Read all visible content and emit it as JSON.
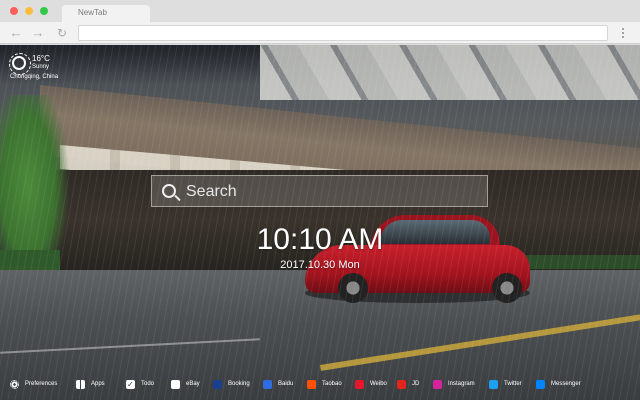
{
  "browser": {
    "tab_title": "NewTab",
    "address_value": "",
    "nav": {
      "back_icon": "←",
      "forward_icon": "→",
      "reload_icon": "↻"
    }
  },
  "weather": {
    "temperature": "16°C",
    "condition": "Sunny",
    "location": "Chongqing, China"
  },
  "search": {
    "placeholder": "Search"
  },
  "clock": {
    "time": "10:10 AM",
    "date": "2017.10.30 Mon"
  },
  "dock": {
    "items": [
      {
        "label": "Preferences",
        "icon": "gear-icon",
        "color": "#ffffff"
      },
      {
        "label": "Apps",
        "icon": "grid-icon",
        "color": "#ffffff"
      },
      {
        "label": "Todo",
        "icon": "checkbox-icon",
        "color": "#ffffff"
      },
      {
        "label": "eBay",
        "icon": "ebay-icon",
        "color": "#ffffff"
      },
      {
        "label": "Booking",
        "icon": "booking-icon",
        "color": "#1a3f8f"
      },
      {
        "label": "Baidu",
        "icon": "baidu-icon",
        "color": "#2f6de1"
      },
      {
        "label": "Taobao",
        "icon": "taobao-icon",
        "color": "#ff5000"
      },
      {
        "label": "Weibo",
        "icon": "weibo-icon",
        "color": "#e6162d"
      },
      {
        "label": "JD",
        "icon": "jd-icon",
        "color": "#e1251b"
      },
      {
        "label": "Instagram",
        "icon": "instagram-icon",
        "color": "#d6249f"
      },
      {
        "label": "Twitter",
        "icon": "twitter-icon",
        "color": "#1da1f2"
      },
      {
        "label": "Messenger",
        "icon": "messenger-icon",
        "color": "#0084ff"
      }
    ]
  }
}
